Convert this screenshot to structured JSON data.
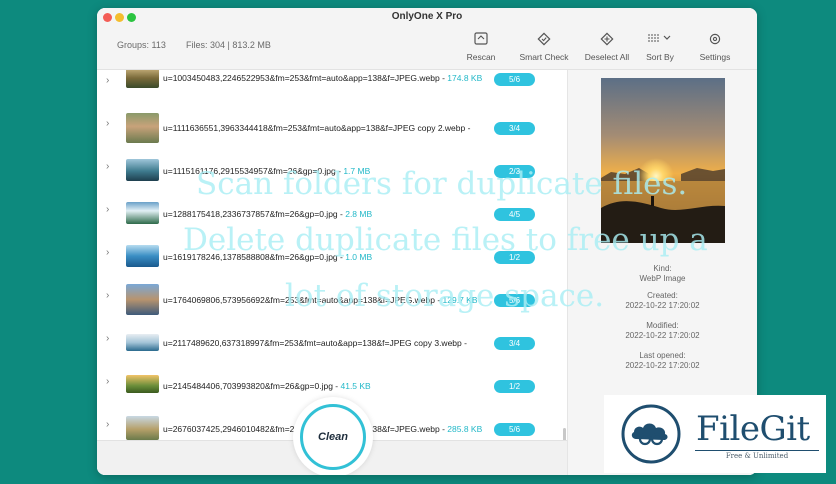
{
  "app": {
    "title": "OnlyOne X Pro"
  },
  "stats": {
    "groups": "Groups: 113",
    "files": "Files: 304 | 813.2 MB"
  },
  "toolbar": {
    "rescan": "Rescan",
    "smart_check": "Smart Check",
    "deselect_all": "Deselect All",
    "sort_by": "Sort By",
    "settings": "Settings"
  },
  "files": [
    {
      "name": "u=1003450483,2246522953&fm=253&fmt=auto&app=138&f=JPEG.webp",
      "sep": " - ",
      "size": "174.8 KB",
      "badge": "5/6"
    },
    {
      "name": "u=1111636551,3963344418&fm=253&fmt=auto&app=138&f=JPEG copy 2.webp",
      "sep": " - ",
      "size": "",
      "badge": "3/4"
    },
    {
      "name": "u=1115161176,2915534957&fm=26&gp=0.jpg",
      "sep": " - ",
      "size": "1.7 MB",
      "badge": "2/3"
    },
    {
      "name": "u=1288175418,2336737857&fm=26&gp=0.jpg",
      "sep": " - ",
      "size": "2.8 MB",
      "badge": "4/5"
    },
    {
      "name": "u=1619178246,1378588808&fm=26&gp=0.jpg",
      "sep": " - ",
      "size": "1.0 MB",
      "badge": "1/2"
    },
    {
      "name": "u=1764069806,573956692&fm=253&fmt=auto&app=138&f=JPEG.webp",
      "sep": " - ",
      "size": "129.7 KB",
      "badge": "5/6"
    },
    {
      "name": "u=2117489620,637318997&fm=253&fmt=auto&app=138&f=JPEG copy 3.webp",
      "sep": " - ",
      "size": "",
      "badge": "3/4"
    },
    {
      "name": "u=2145484406,703993820&fm=26&gp=0.jpg",
      "sep": " - ",
      "size": "41.5 KB",
      "badge": "1/2"
    },
    {
      "name": "u=2676037425,2946010482&fm=253&fmt=auto&app=138&f=JPEG.webp",
      "sep": " - ",
      "size": "285.8 KB",
      "badge": "5/6"
    }
  ],
  "details": {
    "kind_label": "Kind:",
    "kind_value": "WebP Image",
    "created_label": "Created:",
    "created_value": "2022-10-22 17:20:02",
    "modified_label": "Modified:",
    "modified_value": "2022-10-22 17:20:02",
    "opened_label": "Last opened:",
    "opened_value": "2022-10-22 17:20:02"
  },
  "clean_button": "Clean",
  "overlay": {
    "line1": "Scan folders for duplicate files.",
    "line2": "Delete duplicate files to free up a",
    "line3": "lot of storage space."
  },
  "watermark": {
    "brand": "FileGit",
    "tagline": "Free & Unlimited"
  },
  "colors": {
    "accent": "#2fc3df",
    "background": "#0d8a7e",
    "brand": "#1f4e6f"
  }
}
